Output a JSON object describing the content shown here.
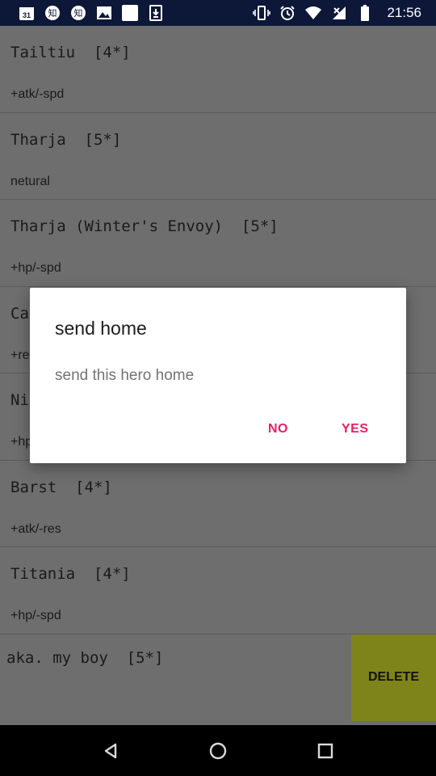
{
  "status_bar": {
    "time": "21:56",
    "left_icons": [
      "calendar-icon",
      "zhi-app-icon",
      "zhi-app-icon",
      "image-icon",
      "blank-square-icon",
      "download-icon"
    ],
    "right_icons": [
      "vibrate-icon",
      "alarm-icon",
      "wifi-icon",
      "no-signal-icon",
      "battery-icon"
    ],
    "calendar_day": "31",
    "zhi_char": "知"
  },
  "list": {
    "items": [
      {
        "title": "Tailtiu  [4*]",
        "subtitle": "+atk/-spd"
      },
      {
        "title": "Tharja  [5*]",
        "subtitle": "netural"
      },
      {
        "title": "Tharja (Winter's Envoy)  [5*]",
        "subtitle": "+hp/-spd"
      },
      {
        "title": "Ca",
        "subtitle": "+re"
      },
      {
        "title": "Ni",
        "subtitle": "+hp"
      },
      {
        "title": "Barst  [4*]",
        "subtitle": "+atk/-res"
      },
      {
        "title": "Titania  [4*]",
        "subtitle": "+hp/-spd"
      }
    ],
    "swiped_item": {
      "title": "aka. my boy  [5*]",
      "delete_label": "DELETE"
    }
  },
  "dialog": {
    "title": "send home",
    "message": "send this hero home",
    "no_label": "NO",
    "yes_label": "YES"
  },
  "nav_bar": {
    "buttons": [
      "back-icon",
      "home-icon",
      "recents-icon"
    ]
  },
  "colors": {
    "status_bar": "#0d1738",
    "scrim_background": "#6e6e6e",
    "accent": "#e91e63",
    "delete_bg": "#7f841a"
  }
}
